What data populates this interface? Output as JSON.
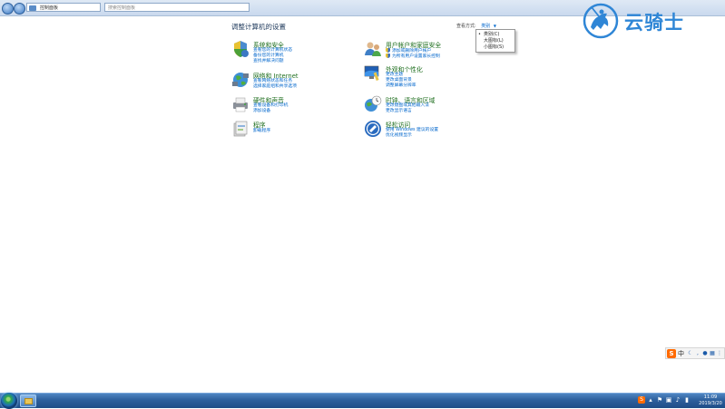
{
  "window": {
    "address": "控制面板",
    "search_placeholder": "搜索控制面板"
  },
  "main": {
    "heading": "调整计算机的设置",
    "view_by_label": "查看方式:",
    "view_by_value": "类别",
    "view_options": [
      {
        "label": "类别(C)",
        "selected": true
      },
      {
        "label": "大图标(L)",
        "selected": false
      },
      {
        "label": "小图标(S)",
        "selected": false
      }
    ]
  },
  "categories": {
    "system_security": {
      "title": "系统和安全",
      "links": [
        "查看您的计算机状态",
        "备份您的计算机",
        "查找并解决问题"
      ]
    },
    "network": {
      "title": "网络和 Internet",
      "links": [
        "查看网络状态和任务",
        "选择家庭组和共享选项"
      ]
    },
    "hardware": {
      "title": "硬件和声音",
      "links": [
        "查看设备和打印机",
        "添加设备"
      ]
    },
    "programs": {
      "title": "程序",
      "links": [
        "卸载程序"
      ]
    },
    "user_accounts": {
      "title": "用户帐户和家庭安全",
      "links": [
        "添加或删除用户帐户",
        "为所有用户设置家长控制"
      ]
    },
    "appearance": {
      "title": "外观和个性化",
      "links": [
        "更改主题",
        "更改桌面背景",
        "调整屏幕分辨率"
      ]
    },
    "clock_region": {
      "title": "时钟、语言和区域",
      "links": [
        "更改键盘或其他输入法",
        "更改显示语言"
      ]
    },
    "ease_access": {
      "title": "轻松访问",
      "links": [
        "使用 Windows 建议的设置",
        "优化视频显示"
      ]
    }
  },
  "logo": {
    "text": "云骑士"
  },
  "ime": {
    "s_label": "S",
    "mode": "中"
  },
  "taskbar": {
    "time": "11:09",
    "date": "2019/3/20"
  }
}
